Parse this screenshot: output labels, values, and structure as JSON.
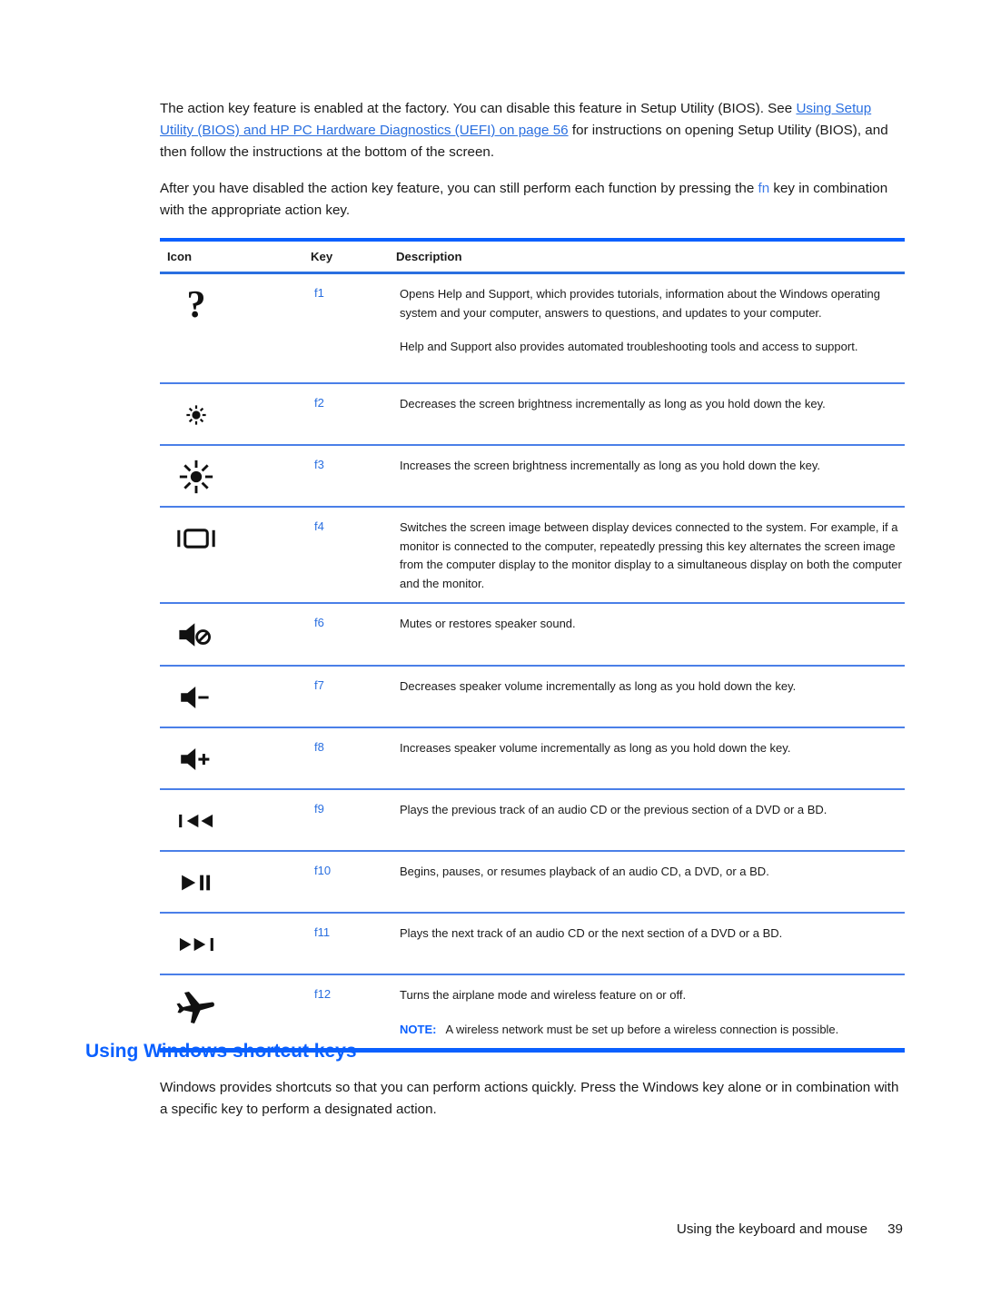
{
  "intro": {
    "p1_a": "The action key feature is enabled at the factory. You can disable this feature in Setup Utility (BIOS). See ",
    "p1_link": "Using Setup Utility (BIOS) and HP PC Hardware Diagnostics (UEFI) on page 56",
    "p1_b": " for instructions on opening Setup Utility (BIOS), and then follow the instructions at the bottom of the screen.",
    "p2_a": "After you have disabled the action key feature, you can still perform each function by pressing the ",
    "p2_key": "fn",
    "p2_b": " key in combination with the appropriate action key."
  },
  "table": {
    "headers": {
      "icon": "Icon",
      "key": "Key",
      "description": "Description"
    },
    "rows": [
      {
        "icon": "question-mark-icon",
        "key": "f1",
        "desc": [
          "Opens Help and Support, which provides tutorials, information about the Windows operating system and your computer, answers to questions, and updates to your computer.",
          "Help and Support also provides automated troubleshooting tools and access to support."
        ]
      },
      {
        "icon": "brightness-decrease-icon",
        "key": "f2",
        "desc": [
          "Decreases the screen brightness incrementally as long as you hold down the key."
        ]
      },
      {
        "icon": "brightness-increase-icon",
        "key": "f3",
        "desc": [
          "Increases the screen brightness incrementally as long as you hold down the key."
        ]
      },
      {
        "icon": "display-switch-icon",
        "key": "f4",
        "desc": [
          "Switches the screen image between display devices connected to the system. For example, if a monitor is connected to the computer, repeatedly pressing this key alternates the screen image from the computer display to the monitor display to a simultaneous display on both the computer and the monitor."
        ]
      },
      {
        "icon": "speaker-mute-icon",
        "key": "f6",
        "desc": [
          "Mutes or restores speaker sound."
        ]
      },
      {
        "icon": "volume-down-icon",
        "key": "f7",
        "desc": [
          "Decreases speaker volume incrementally as long as you hold down the key."
        ]
      },
      {
        "icon": "volume-up-icon",
        "key": "f8",
        "desc": [
          "Increases speaker volume incrementally as long as you hold down the key."
        ]
      },
      {
        "icon": "previous-track-icon",
        "key": "f9",
        "desc": [
          "Plays the previous track of an audio CD or the previous section of a DVD or a BD."
        ]
      },
      {
        "icon": "play-pause-icon",
        "key": "f10",
        "desc": [
          "Begins, pauses, or resumes playback of an audio CD, a DVD, or a BD."
        ]
      },
      {
        "icon": "next-track-icon",
        "key": "f11",
        "desc": [
          "Plays the next track of an audio CD or the next section of a DVD or a BD."
        ]
      },
      {
        "icon": "airplane-mode-icon",
        "key": "f12",
        "desc": [
          "Turns the airplane mode and wireless feature on or off."
        ],
        "note_label": "NOTE:",
        "note_text": "A wireless network must be set up before a wireless connection is possible."
      }
    ]
  },
  "section": {
    "heading": "Using Windows shortcut keys",
    "body": "Windows provides shortcuts so that you can perform actions quickly. Press the Windows key alone or in combination with a specific key to perform a designated action."
  },
  "footer": {
    "title": "Using the keyboard and mouse",
    "page_number": "39"
  },
  "colors": {
    "accent_blue": "#0a60ff",
    "link_blue": "#2a6fe0",
    "rule_light": "#4a7fe8",
    "text": "#1a1a1a"
  }
}
